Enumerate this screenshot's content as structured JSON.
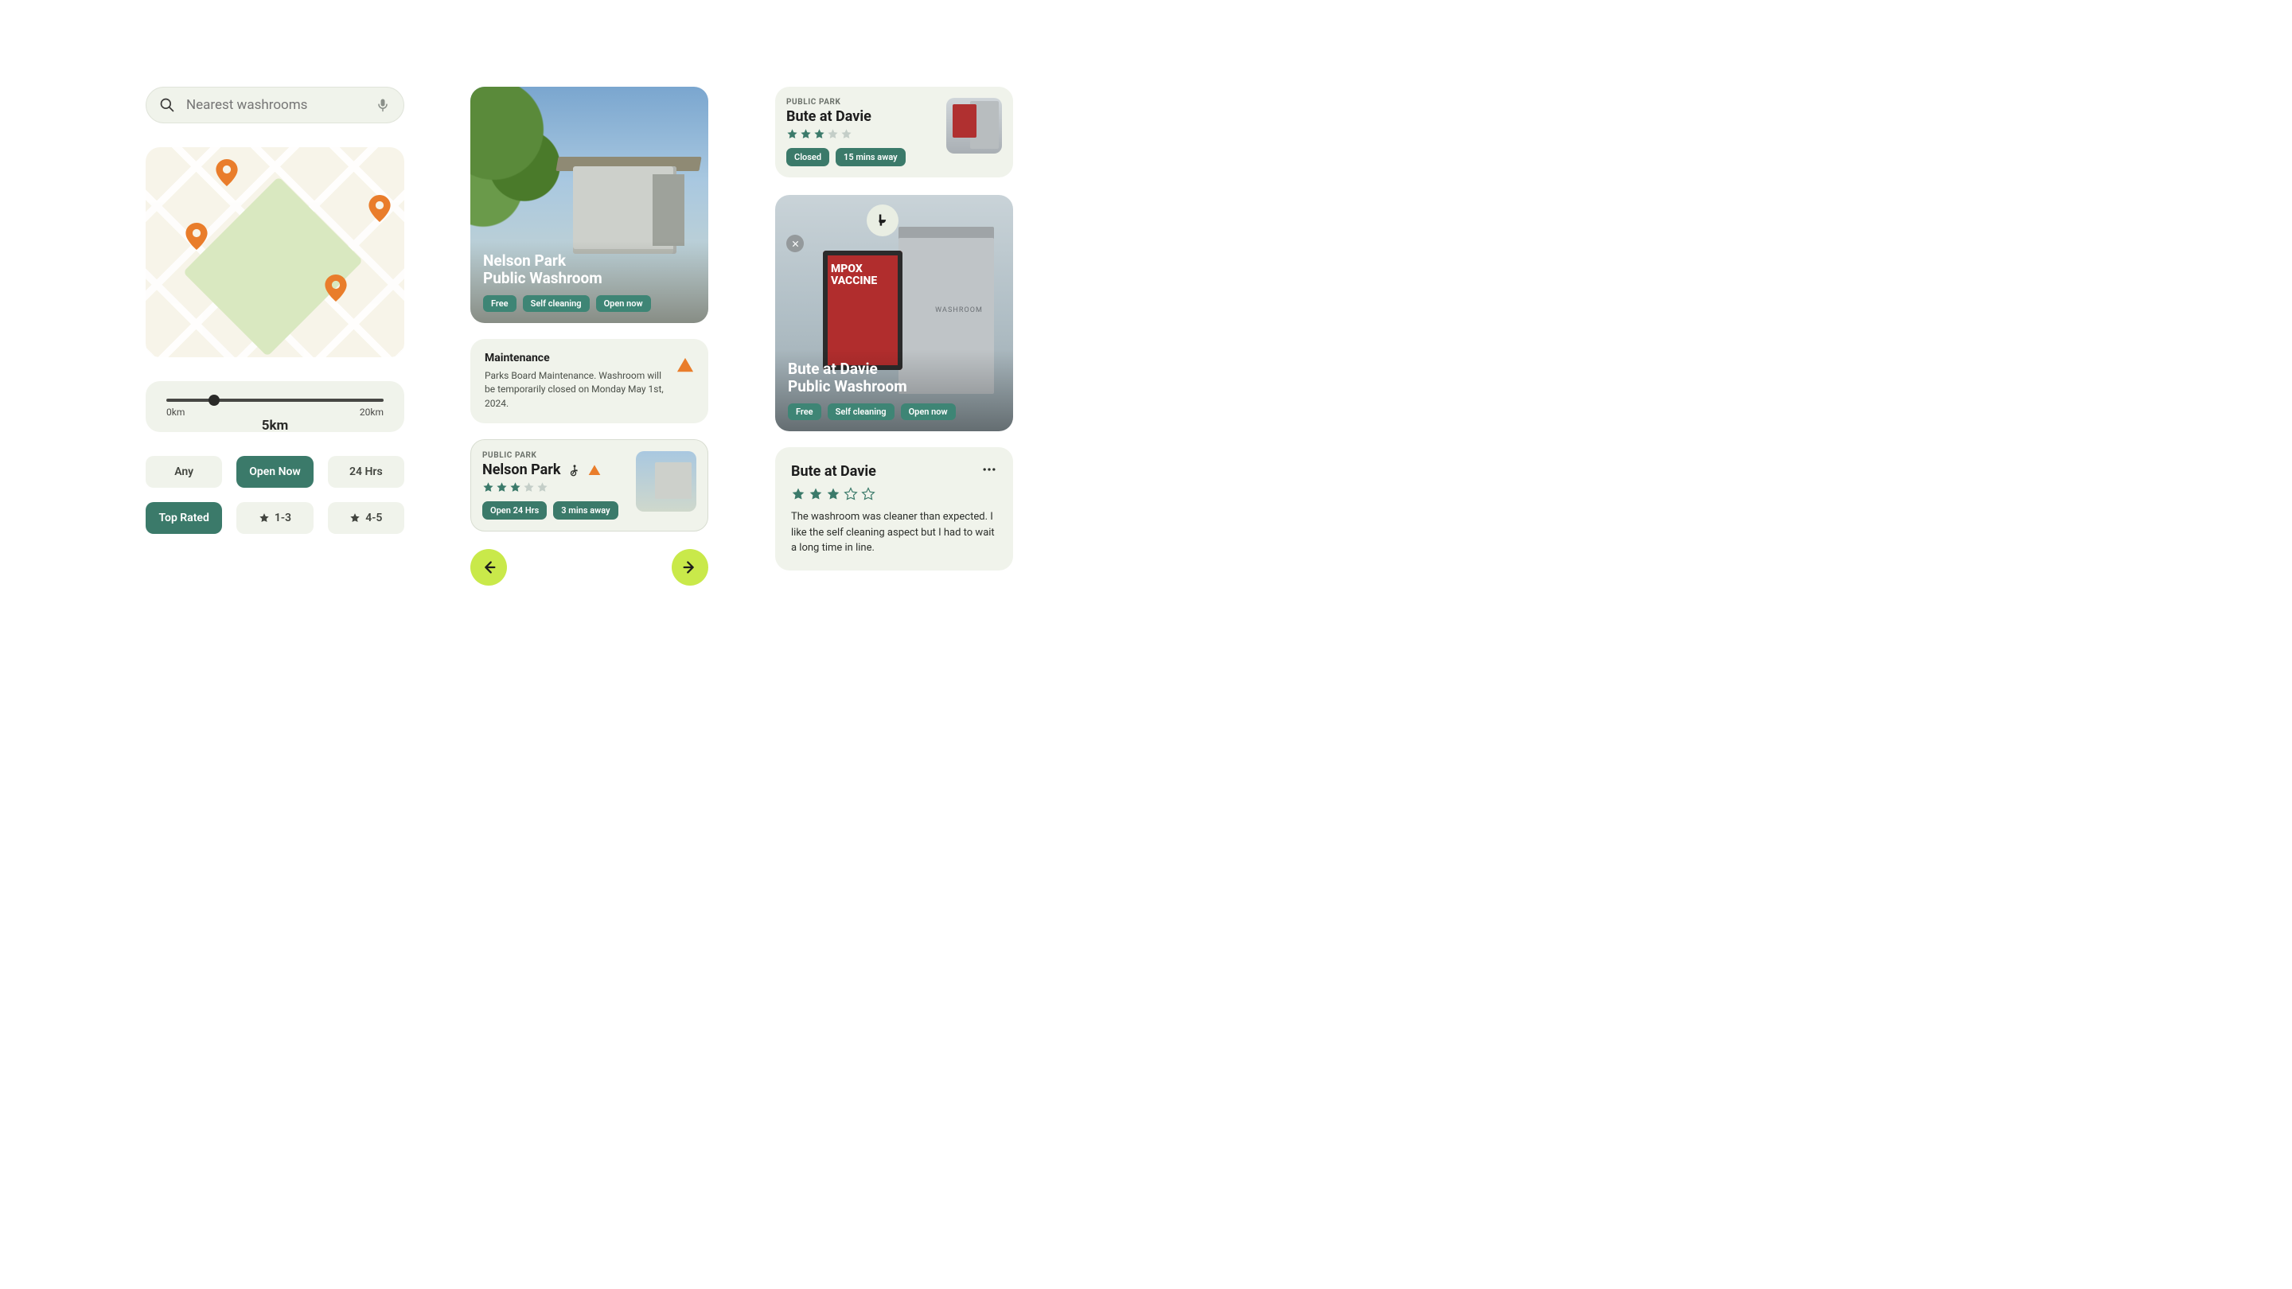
{
  "search": {
    "placeholder": "Nearest washrooms"
  },
  "slider": {
    "min_label": "0km",
    "max_label": "20km",
    "value_label": "5km"
  },
  "filters": {
    "any": "Any",
    "open_now": "Open Now",
    "hrs24": "24 Hrs",
    "top_rated": "Top Rated",
    "r13": "1-3",
    "r45": "4-5"
  },
  "nelson_hero": {
    "title_line1": "Nelson Park",
    "title_line2": "Public Washroom",
    "tags": {
      "free": "Free",
      "self_cleaning": "Self cleaning",
      "open_now": "Open now"
    }
  },
  "maintenance": {
    "title": "Maintenance",
    "body": "Parks Board Maintenance. Washroom will be temporarily closed on Monday May 1st, 2024."
  },
  "nelson_card": {
    "eyebrow": "PUBLIC PARK",
    "title": "Nelson Park",
    "rating": 3,
    "pills": {
      "open24": "Open 24 Hrs",
      "distance": "3 mins away"
    }
  },
  "bute_small": {
    "eyebrow": "PUBLIC PARK",
    "title": "Bute at Davie",
    "rating": 3,
    "pills": {
      "closed": "Closed",
      "distance": "15 mins away"
    }
  },
  "bute_hero": {
    "title_line1": "Bute at Davie",
    "title_line2": "Public Washroom",
    "poster_line1": "MPOX",
    "poster_line2": "VACCINE",
    "kiosk_label": "WASHROOM",
    "tags": {
      "free": "Free",
      "self_cleaning": "Self cleaning",
      "open_now": "Open now"
    }
  },
  "review": {
    "title": "Bute at Davie",
    "rating": 3,
    "body": "The washroom was cleaner than expected. I like the self cleaning aspect but I had to wait a long time in line."
  }
}
